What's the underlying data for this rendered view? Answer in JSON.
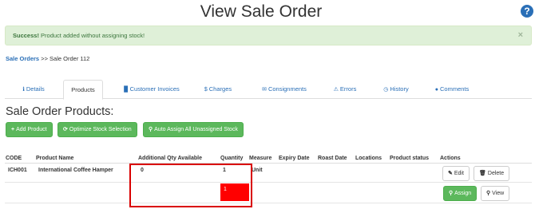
{
  "page": {
    "title": "View Sale Order",
    "help_icon": "help-icon"
  },
  "alert": {
    "strong": "Success!",
    "message": " Product added without assigning stock!",
    "close": "×"
  },
  "breadcrumb": {
    "link": "Sale Orders",
    "sep": " >> ",
    "current": "Sale Order 112"
  },
  "tabs": [
    {
      "label": "Details",
      "icon": "info-icon",
      "glyph": "ℹ"
    },
    {
      "label": "Products",
      "icon": "",
      "glyph": ""
    },
    {
      "label": "Customer Invoices",
      "icon": "file-icon",
      "glyph": "▉"
    },
    {
      "label": "Charges",
      "icon": "dollar-icon",
      "glyph": "$"
    },
    {
      "label": "Consignments",
      "icon": "envelope-icon",
      "glyph": "✉"
    },
    {
      "label": "Errors",
      "icon": "warning-icon",
      "glyph": "⚠"
    },
    {
      "label": "History",
      "icon": "clock-icon",
      "glyph": "◷"
    },
    {
      "label": "Comments",
      "icon": "comment-icon",
      "glyph": "●"
    }
  ],
  "section": {
    "title": "Sale Order Products:"
  },
  "actions": {
    "add_product": "Add Product",
    "optimize": "Optimize Stock Selection",
    "auto_assign": "Auto Assign All Unassigned Stock"
  },
  "table": {
    "headers": [
      "CODE",
      "Product Name",
      "Additional Qty Available",
      "Quantity",
      "Measure",
      "Expiry Date",
      "Roast Date",
      "Locations",
      "Product status",
      "Actions"
    ],
    "row": {
      "code": "ICH001",
      "name": "International Coffee Hamper",
      "additional_qty": "0",
      "quantity": "1",
      "measure": "Unit",
      "red_qty": "1",
      "edit": "Edit",
      "delete": "Delete",
      "assign": "Assign",
      "view": "View"
    }
  },
  "colors": {
    "accent": "#2a6fb7",
    "success": "#5cb85c",
    "alert_bg": "#dff0d8",
    "highlight": "#d90000",
    "qty_fill": "#ff0000"
  }
}
